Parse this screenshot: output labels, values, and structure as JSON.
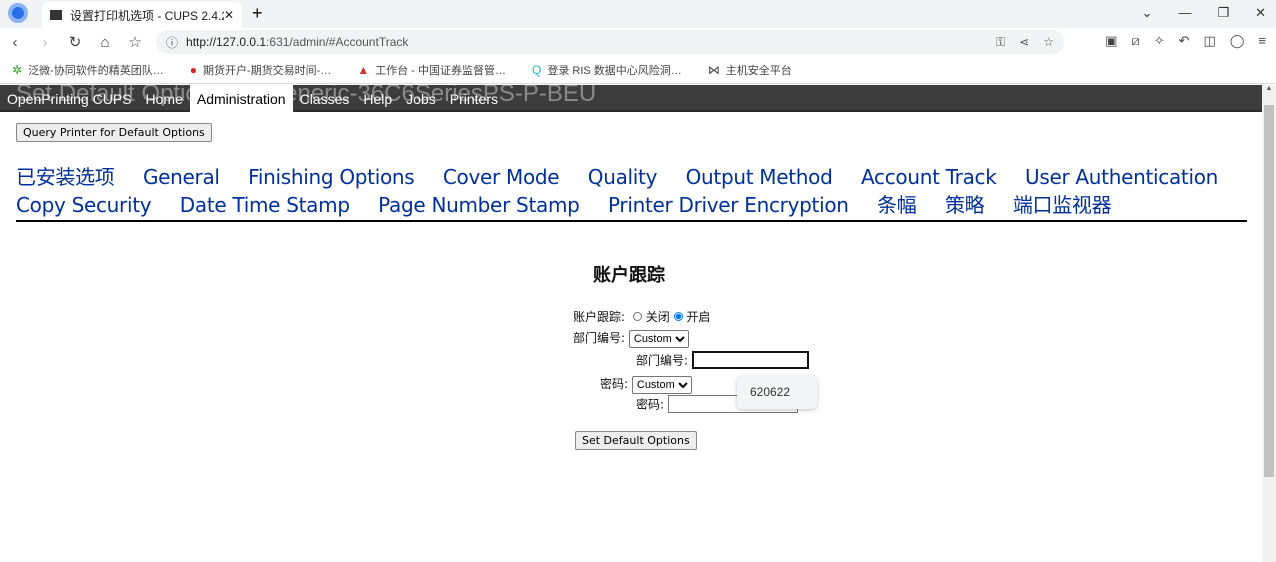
{
  "browser": {
    "tab_title": "设置打印机选项 - CUPS 2.4.2",
    "url_host": "http://127.0.0.1",
    "url_path": ":631/admin/#AccountTrack",
    "bookmarks": [
      "泛微-协同软件的精英团队…",
      "期货开户-期货交易时间-…",
      "工作台 - 中国证券监督管…",
      "登录 RIS 数据中心风险洞…",
      "主机安全平台"
    ]
  },
  "page": {
    "bg_title": "Set Default Options for Generic-36C6SeriesPS-P-BEU",
    "nav": [
      "OpenPrinting CUPS",
      "Home",
      "Administration",
      "Classes",
      "Help",
      "Jobs",
      "Printers"
    ],
    "query_button": "Query Printer for Default Options",
    "option_tabs": [
      "已安装选项",
      "General",
      "Finishing Options",
      "Cover Mode",
      "Quality",
      "Output Method",
      "Account Track",
      "User Authentication",
      "Copy Security",
      "Date Time Stamp",
      "Page Number Stamp",
      "Printer Driver Encryption",
      "条幅",
      "策略",
      "端口监视器"
    ],
    "section_title": "账户跟踪",
    "account_track_label": "账户跟踪:",
    "off": "关闭",
    "on": "开启",
    "dept_label": "部门编号:",
    "dept_select": "Custom",
    "dept_input_label": "部门编号:",
    "pwd_label": "密码:",
    "pwd_select": "Custom",
    "pwd_input_label": "密码:",
    "autocomplete": "620622",
    "submit": "Set Default Options"
  }
}
